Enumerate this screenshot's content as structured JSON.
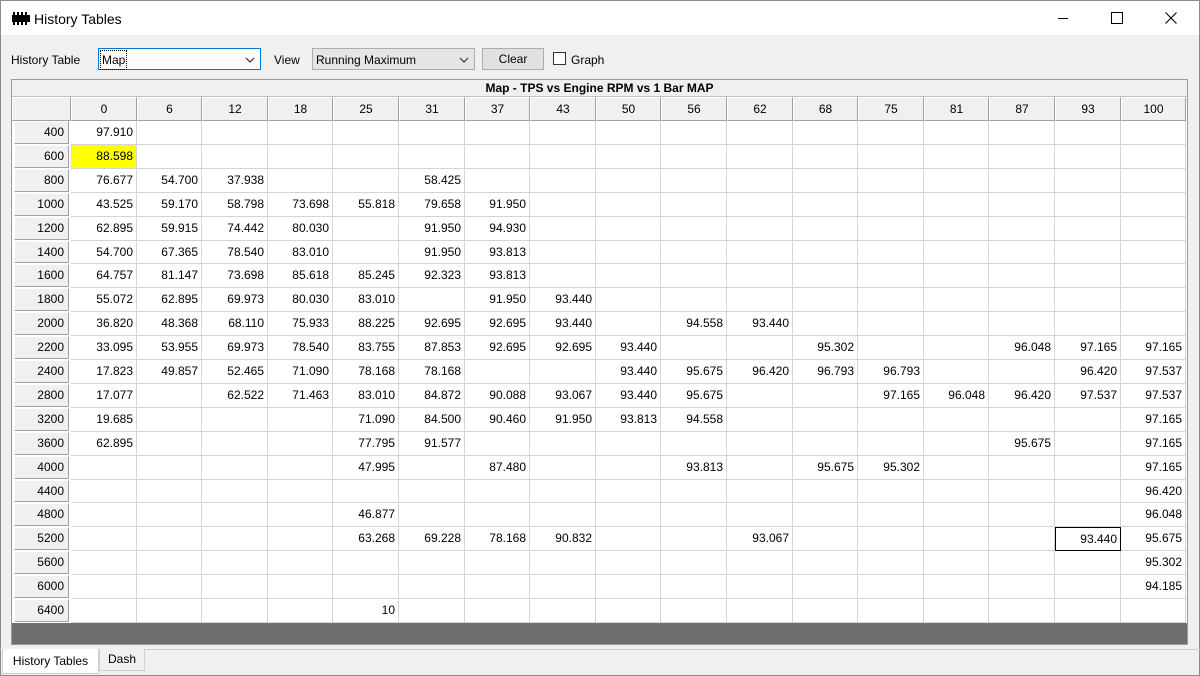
{
  "window": {
    "title": "History Tables"
  },
  "toolbar": {
    "history_table_label": "History Table",
    "history_table_value": "Map",
    "view_label": "View",
    "view_value": "Running Maximum",
    "clear_label": "Clear",
    "graph_label": "Graph",
    "graph_checked": false
  },
  "table": {
    "title": "Map - TPS vs Engine RPM vs 1 Bar MAP",
    "columns": [
      "0",
      "6",
      "12",
      "18",
      "25",
      "31",
      "37",
      "43",
      "50",
      "56",
      "62",
      "68",
      "75",
      "81",
      "87",
      "93",
      "100"
    ],
    "rows": [
      {
        "rpm": "400",
        "cells": [
          "97.910",
          "",
          "",
          "",
          "",
          "",
          "",
          "",
          "",
          "",
          "",
          "",
          "",
          "",
          "",
          "",
          ""
        ]
      },
      {
        "rpm": "600",
        "cells": [
          "88.598",
          "",
          "",
          "",
          "",
          "",
          "",
          "",
          "",
          "",
          "",
          "",
          "",
          "",
          "",
          "",
          ""
        ]
      },
      {
        "rpm": "800",
        "cells": [
          "76.677",
          "54.700",
          "37.938",
          "",
          "",
          "58.425",
          "",
          "",
          "",
          "",
          "",
          "",
          "",
          "",
          "",
          "",
          ""
        ]
      },
      {
        "rpm": "1000",
        "cells": [
          "43.525",
          "59.170",
          "58.798",
          "73.698",
          "55.818",
          "79.658",
          "91.950",
          "",
          "",
          "",
          "",
          "",
          "",
          "",
          "",
          "",
          ""
        ]
      },
      {
        "rpm": "1200",
        "cells": [
          "62.895",
          "59.915",
          "74.442",
          "80.030",
          "",
          "91.950",
          "94.930",
          "",
          "",
          "",
          "",
          "",
          "",
          "",
          "",
          "",
          ""
        ]
      },
      {
        "rpm": "1400",
        "cells": [
          "54.700",
          "67.365",
          "78.540",
          "83.010",
          "",
          "91.950",
          "93.813",
          "",
          "",
          "",
          "",
          "",
          "",
          "",
          "",
          "",
          ""
        ]
      },
      {
        "rpm": "1600",
        "cells": [
          "64.757",
          "81.147",
          "73.698",
          "85.618",
          "85.245",
          "92.323",
          "93.813",
          "",
          "",
          "",
          "",
          "",
          "",
          "",
          "",
          "",
          ""
        ]
      },
      {
        "rpm": "1800",
        "cells": [
          "55.072",
          "62.895",
          "69.973",
          "80.030",
          "83.010",
          "",
          "91.950",
          "93.440",
          "",
          "",
          "",
          "",
          "",
          "",
          "",
          "",
          ""
        ]
      },
      {
        "rpm": "2000",
        "cells": [
          "36.820",
          "48.368",
          "68.110",
          "75.933",
          "88.225",
          "92.695",
          "92.695",
          "93.440",
          "",
          "94.558",
          "93.440",
          "",
          "",
          "",
          "",
          "",
          ""
        ]
      },
      {
        "rpm": "2200",
        "cells": [
          "33.095",
          "53.955",
          "69.973",
          "78.540",
          "83.755",
          "87.853",
          "92.695",
          "92.695",
          "93.440",
          "",
          "",
          "95.302",
          "",
          "",
          "96.048",
          "97.165",
          "97.165"
        ]
      },
      {
        "rpm": "2400",
        "cells": [
          "17.823",
          "49.857",
          "52.465",
          "71.090",
          "78.168",
          "78.168",
          "",
          "",
          "93.440",
          "95.675",
          "96.420",
          "96.793",
          "96.793",
          "",
          "",
          "96.420",
          "97.537"
        ]
      },
      {
        "rpm": "2800",
        "cells": [
          "17.077",
          "",
          "62.522",
          "71.463",
          "83.010",
          "84.872",
          "90.088",
          "93.067",
          "93.440",
          "95.675",
          "",
          "",
          "97.165",
          "96.048",
          "96.420",
          "97.537",
          "97.537"
        ]
      },
      {
        "rpm": "3200",
        "cells": [
          "19.685",
          "",
          "",
          "",
          "71.090",
          "84.500",
          "90.460",
          "91.950",
          "93.813",
          "94.558",
          "",
          "",
          "",
          "",
          "",
          "",
          "97.165"
        ]
      },
      {
        "rpm": "3600",
        "cells": [
          "62.895",
          "",
          "",
          "",
          "77.795",
          "91.577",
          "",
          "",
          "",
          "",
          "",
          "",
          "",
          "",
          "95.675",
          "",
          "97.165"
        ]
      },
      {
        "rpm": "4000",
        "cells": [
          "",
          "",
          "",
          "",
          "47.995",
          "",
          "87.480",
          "",
          "",
          "93.813",
          "",
          "95.675",
          "95.302",
          "",
          "",
          "",
          "97.165"
        ]
      },
      {
        "rpm": "4400",
        "cells": [
          "",
          "",
          "",
          "",
          "",
          "",
          "",
          "",
          "",
          "",
          "",
          "",
          "",
          "",
          "",
          "",
          "96.420"
        ]
      },
      {
        "rpm": "4800",
        "cells": [
          "",
          "",
          "",
          "",
          "46.877",
          "",
          "",
          "",
          "",
          "",
          "",
          "",
          "",
          "",
          "",
          "",
          "96.048"
        ]
      },
      {
        "rpm": "5200",
        "cells": [
          "",
          "",
          "",
          "",
          "63.268",
          "69.228",
          "78.168",
          "90.832",
          "",
          "",
          "93.067",
          "",
          "",
          "",
          "",
          "93.440",
          "95.675"
        ]
      },
      {
        "rpm": "5600",
        "cells": [
          "",
          "",
          "",
          "",
          "",
          "",
          "",
          "",
          "",
          "",
          "",
          "",
          "",
          "",
          "",
          "",
          "95.302"
        ]
      },
      {
        "rpm": "6000",
        "cells": [
          "",
          "",
          "",
          "",
          "",
          "",
          "",
          "",
          "",
          "",
          "",
          "",
          "",
          "",
          "",
          "",
          "94.185"
        ]
      },
      {
        "rpm": "6400",
        "cells": [
          "",
          "",
          "",
          "",
          "10",
          "",
          "",
          "",
          "",
          "",
          "",
          "",
          "",
          "",
          "",
          "",
          ""
        ]
      }
    ],
    "highlighted_cell": {
      "row": 1,
      "col": 0,
      "color": "#ffff00"
    },
    "selected_cell": {
      "row": 17,
      "col": 15
    }
  },
  "tabs": [
    {
      "label": "History Tables",
      "active": true
    },
    {
      "label": "Dash",
      "active": false
    }
  ]
}
